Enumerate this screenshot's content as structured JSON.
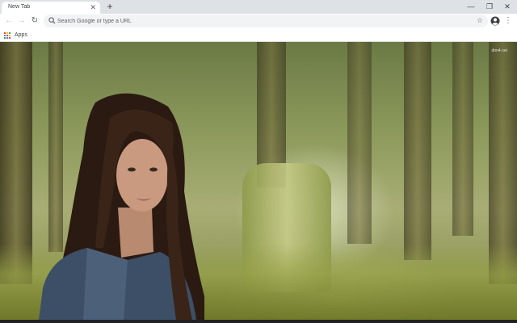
{
  "tab": {
    "title": "New Tab",
    "close_glyph": "✕"
  },
  "new_tab_glyph": "+",
  "window_controls": {
    "minimize": "—",
    "maximize": "❐",
    "close": "✕"
  },
  "toolbar": {
    "back_glyph": "←",
    "forward_glyph": "→",
    "reload_glyph": "↻",
    "star_glyph": "☆",
    "menu_glyph": "⋮"
  },
  "omnibox": {
    "placeholder": "Search Google or type a URL",
    "value": ""
  },
  "bookmarks": {
    "apps_label": "Apps"
  },
  "apps_icon_colors": [
    "#ea4335",
    "#fbbc05",
    "#34a853",
    "#4285f4",
    "#ea4335",
    "#fbbc05",
    "#34a853",
    "#4285f4",
    "#ea4335"
  ],
  "wallpaper": {
    "watermark": "dtm4.net"
  },
  "colors": {
    "tabstrip": "#dee1e6",
    "toolbar": "#ffffff",
    "omnibox": "#f1f3f4"
  }
}
